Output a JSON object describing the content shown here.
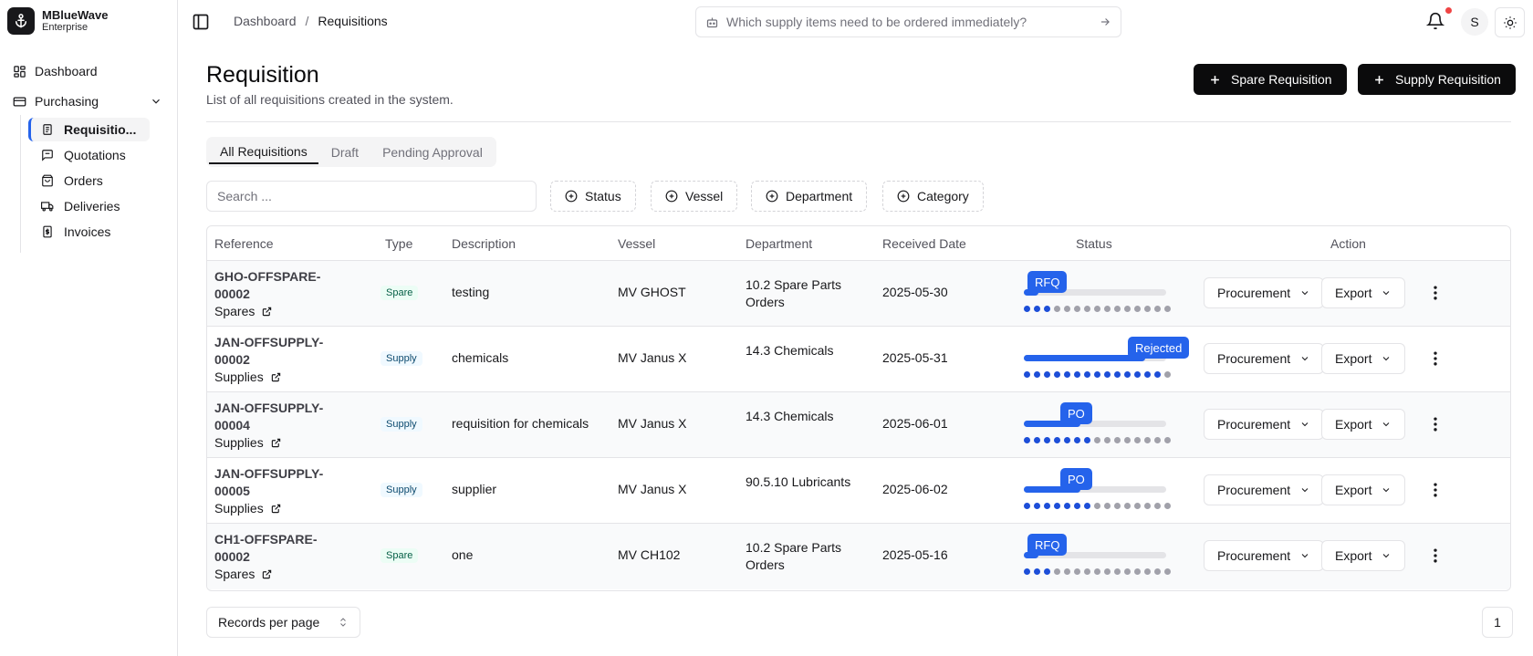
{
  "brand": {
    "name": "MBlueWave",
    "subtitle": "Enterprise"
  },
  "sidebar": {
    "dashboard": "Dashboard",
    "purchasing": "Purchasing",
    "sub_items": [
      {
        "label": "Requisitio...",
        "icon": "requisition-icon",
        "active": true
      },
      {
        "label": "Quotations",
        "icon": "quotation-icon"
      },
      {
        "label": "Orders",
        "icon": "orders-icon"
      },
      {
        "label": "Deliveries",
        "icon": "truck-icon"
      },
      {
        "label": "Invoices",
        "icon": "invoice-icon"
      }
    ]
  },
  "topbar": {
    "breadcrumb": [
      "Dashboard",
      "Requisitions"
    ],
    "search_placeholder": "Which supply items need to be ordered immediately?",
    "avatar_initial": "S"
  },
  "header": {
    "title": "Requisition",
    "subtitle": "List of all requisitions created in the system.",
    "spare_button": "Spare Requisition",
    "supply_button": "Supply Requisition"
  },
  "tabs": [
    "All Requisitions",
    "Draft",
    "Pending Approval"
  ],
  "filters": {
    "search_placeholder": "Search ...",
    "status": "Status",
    "vessel": "Vessel",
    "department": "Department",
    "category": "Category"
  },
  "table": {
    "headers": [
      "Reference",
      "Type",
      "Description",
      "Vessel",
      "Department",
      "Received Date",
      "Status",
      "Action"
    ],
    "rows": [
      {
        "ref1": "GHO-OFFSPARE-",
        "ref2": "00002",
        "ref_type": "Spares",
        "type": "Spare",
        "description": "testing",
        "vessel": "MV GHOST",
        "department": "10.2 Spare Parts Orders",
        "date": "2025-05-30",
        "status": "RFQ",
        "progress": 0.1,
        "done_steps": 3,
        "procurement": "Procurement",
        "export": "Export"
      },
      {
        "ref1": "JAN-OFFSUPPLY-",
        "ref2": "00002",
        "ref_type": "Supplies",
        "type": "Supply",
        "description": "chemicals",
        "vessel": "MV Janus X",
        "department": "14.3 Chemicals",
        "date": "2025-05-31",
        "status": "Rejected",
        "progress": 0.85,
        "done_steps": 14,
        "procurement": "Procurement",
        "export": "Export"
      },
      {
        "ref1": "JAN-OFFSUPPLY-",
        "ref2": "00004",
        "ref_type": "Supplies",
        "type": "Supply",
        "description": "requisition for chemicals",
        "vessel": "MV Janus X",
        "department": "14.3 Chemicals",
        "date": "2025-06-01",
        "status": "PO",
        "progress": 0.4,
        "done_steps": 7,
        "procurement": "Procurement",
        "export": "Export"
      },
      {
        "ref1": "JAN-OFFSUPPLY-",
        "ref2": "00005",
        "ref_type": "Supplies",
        "type": "Supply",
        "description": "supplier",
        "vessel": "MV Janus X",
        "department": "90.5.10 Lubricants",
        "date": "2025-06-02",
        "status": "PO",
        "progress": 0.4,
        "done_steps": 7,
        "procurement": "Procurement",
        "export": "Export"
      },
      {
        "ref1": "CH1-OFFSPARE-",
        "ref2": "00002",
        "ref_type": "Spares",
        "type": "Spare",
        "description": "one",
        "vessel": "MV CH102",
        "department": "10.2 Spare Parts Orders",
        "date": "2025-05-16",
        "status": "RFQ",
        "progress": 0.1,
        "done_steps": 3,
        "procurement": "Procurement",
        "export": "Export"
      }
    ]
  },
  "footer": {
    "records_per_page": "Records per page",
    "page": "1"
  },
  "colors": {
    "accent": "#2563eb",
    "dark_button": "#0b0b0c",
    "notification": "#ef4444"
  }
}
